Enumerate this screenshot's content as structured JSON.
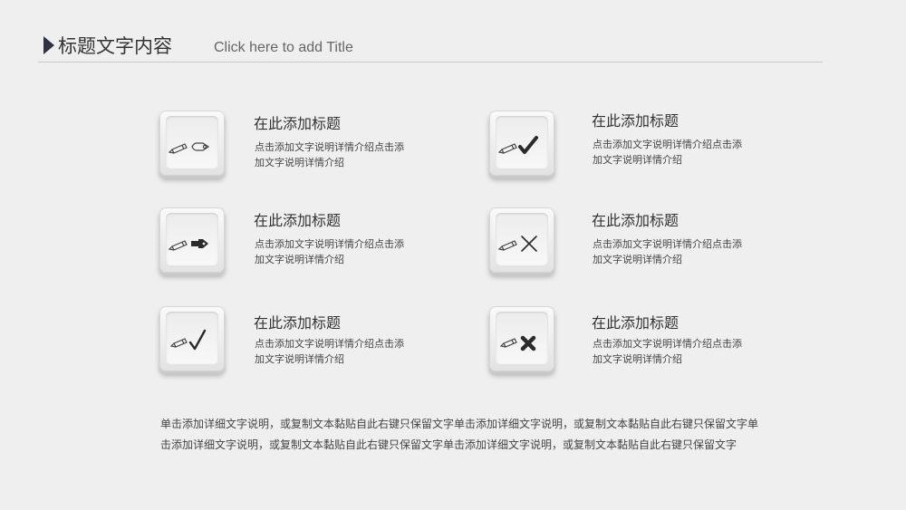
{
  "header": {
    "title": "标题文字内容",
    "subtitle": "Click here to add Title"
  },
  "items": [
    {
      "title": "在此添加标题",
      "desc": "点击添加文字说明详情介绍点击添加文字说明详情介绍",
      "icon": "pencil-pen-nib-icon"
    },
    {
      "title": "在此添加标题",
      "desc": "点击添加文字说明详情介绍点击添加文字说明详情介绍",
      "icon": "pencil-check-bold-icon"
    },
    {
      "title": "在此添加标题",
      "desc": "点击添加文字说明详情介绍点击添加文字说明详情介绍",
      "icon": "pencil-pen-filled-icon"
    },
    {
      "title": "在此添加标题",
      "desc": "点击添加文字说明详情介绍点击添加文字说明详情介绍",
      "icon": "pencil-cross-icon"
    },
    {
      "title": "在此添加标题",
      "desc": "点击添加文字说明详情介绍点击添加文字说明详情介绍",
      "icon": "pencil-check-icon"
    },
    {
      "title": "在此添加标题",
      "desc": "点击添加文字说明详情介绍点击添加文字说明详情介绍",
      "icon": "pencil-x-bold-icon"
    }
  ],
  "footer": {
    "text": "单击添加详细文字说明，或复制文本黏贴自此右键只保留文字单击添加详细文字说明，或复制文本黏贴自此右键只保留文字单击添加详细文字说明，或复制文本黏贴自此右键只保留文字单击添加详细文字说明，或复制文本黏贴自此右键只保留文字"
  },
  "colors": {
    "background": "#efefef",
    "accent": "#2f3340"
  }
}
